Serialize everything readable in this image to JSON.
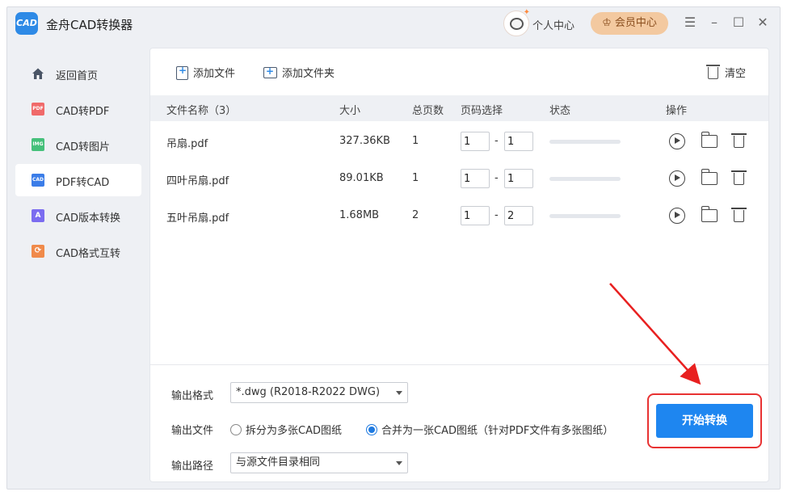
{
  "app": {
    "logo_text": "CAD",
    "title": "金舟CAD转换器",
    "user_center": "个人中心",
    "vip_label": "会员中心"
  },
  "window_controls": [
    "menu-icon",
    "minimize-icon",
    "maximize-icon",
    "close-icon"
  ],
  "sidebar": {
    "items": [
      {
        "label": "返回首页",
        "icon": "home-icon",
        "icon_text": "",
        "color": "#4a5566",
        "active": false
      },
      {
        "label": "CAD转PDF",
        "icon": "pdf-icon",
        "icon_text": "PDF",
        "color": "#f06a6a",
        "active": false
      },
      {
        "label": "CAD转图片",
        "icon": "image-icon",
        "icon_text": "IMG",
        "color": "#45c07a",
        "active": false
      },
      {
        "label": "PDF转CAD",
        "icon": "cad-icon",
        "icon_text": "CAD",
        "color": "#3b7de8",
        "active": true
      },
      {
        "label": "CAD版本转换",
        "icon": "version-icon",
        "icon_text": "A",
        "color": "#7b6cf0",
        "active": false
      },
      {
        "label": "CAD格式互转",
        "icon": "format-icon",
        "icon_text": "⟳",
        "color": "#f08a4a",
        "active": false
      }
    ]
  },
  "toolbar": {
    "add_file": "添加文件",
    "add_folder": "添加文件夹",
    "clear": "清空"
  },
  "table": {
    "headers": {
      "name": "文件名称（3）",
      "size": "大小",
      "pages": "总页数",
      "page_select": "页码选择",
      "status": "状态",
      "actions": "操作"
    },
    "rows": [
      {
        "name": "吊扇.pdf",
        "size": "327.36KB",
        "pages": "1",
        "from": "1",
        "to": "1",
        "progress": 0
      },
      {
        "name": "四叶吊扇.pdf",
        "size": "89.01KB",
        "pages": "1",
        "from": "1",
        "to": "1",
        "progress": 0
      },
      {
        "name": "五叶吊扇.pdf",
        "size": "1.68MB",
        "pages": "2",
        "from": "1",
        "to": "2",
        "progress": 0
      }
    ],
    "separator": "-"
  },
  "options": {
    "format_label": "输出格式",
    "format_value": "*.dwg (R2018-R2022 DWG)",
    "file_label": "输出文件",
    "split_option": "拆分为多张CAD图纸",
    "merge_option": "合并为一张CAD图纸（针对PDF文件有多张图纸）",
    "selected": "merge",
    "path_label": "输出路径",
    "path_value": "与源文件目录相同"
  },
  "start_button": "开始转换",
  "colors": {
    "accent": "#1e86f0",
    "highlight": "#e83232",
    "vip_bg": "#f3c9a0"
  }
}
